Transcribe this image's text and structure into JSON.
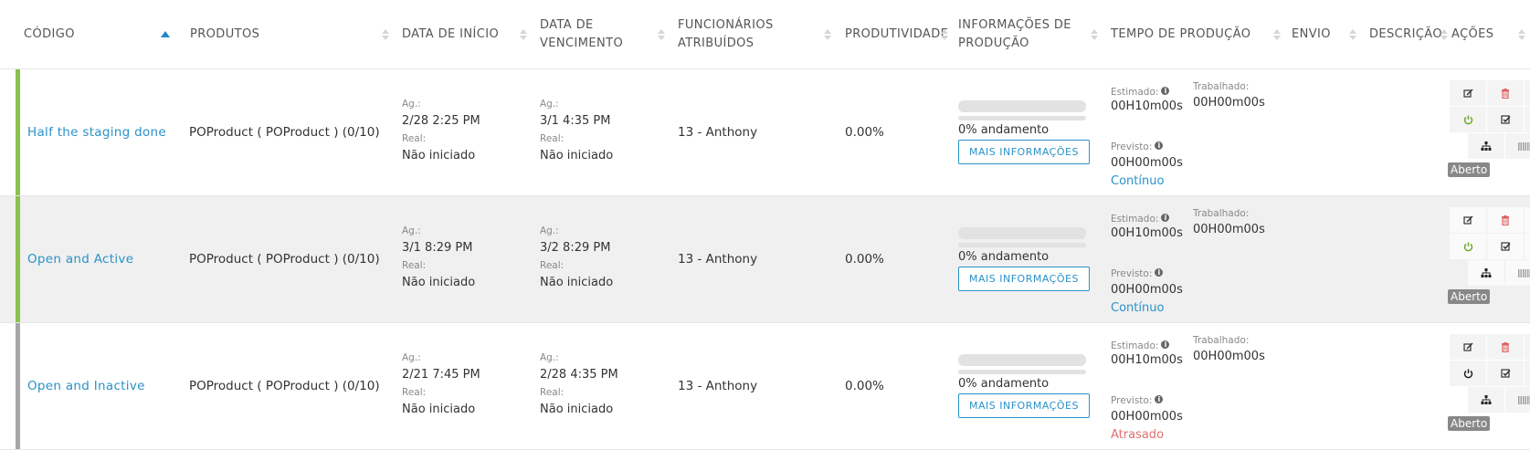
{
  "columns": [
    {
      "label": "CÓDIGO"
    },
    {
      "label": "PRODUTOS"
    },
    {
      "label": "DATA DE INÍCIO"
    },
    {
      "label": "DATA DE\nVENCIMENTO"
    },
    {
      "label": "FUNCIONÁRIOS\nATRIBUÍDOS"
    },
    {
      "label": "PRODUTIVIDADE"
    },
    {
      "label": "INFORMAÇÕES DE\nPRODUÇÃO"
    },
    {
      "label": "TEMPO DE PRODUÇÃO"
    },
    {
      "label": "ENVIO"
    },
    {
      "label": "DESCRIÇÃO"
    },
    {
      "label": "AÇÕES"
    }
  ],
  "labels": {
    "planned": "Ag.:",
    "real": "Real:",
    "estimated": "Estimado:",
    "worked": "Trabalhado:",
    "forecast": "Previsto:",
    "more_info": "MAIS INFORMAÇÕES"
  },
  "rows": [
    {
      "code": "Half the staging done",
      "product": "POProduct ( POProduct ) (0/10)",
      "start_planned": "2/28   2:25 PM",
      "start_real": "Não iniciado",
      "due_planned": "3/1   4:35 PM",
      "due_real": "Não iniciado",
      "assigned": "13 - Anthony",
      "productivity": "0.00%",
      "progress_label": "0% andamento",
      "progress": 0,
      "estimated": "00H10m00s",
      "worked": "00H00m00s",
      "forecast": "00H00m00s",
      "status_text": "Contínuo",
      "badge": "Aberto",
      "stripe_color": "#8cc14c",
      "power_color": "#6aaa2a"
    },
    {
      "code": "Open and Active",
      "product": "POProduct ( POProduct ) (0/10)",
      "start_planned": "3/1   8:29 PM",
      "start_real": "Não iniciado",
      "due_planned": "3/2   8:29 PM",
      "due_real": "Não iniciado",
      "assigned": "13 - Anthony",
      "productivity": "0.00%",
      "progress_label": "0% andamento",
      "progress": 0,
      "estimated": "00H10m00s",
      "worked": "00H00m00s",
      "forecast": "00H00m00s",
      "status_text": "Contínuo",
      "badge": "Aberto",
      "stripe_color": "#8cc14c",
      "power_color": "#6aaa2a"
    },
    {
      "code": "Open and Inactive",
      "product": "POProduct ( POProduct ) (0/10)",
      "start_planned": "2/21   7:45 PM",
      "start_real": "Não iniciado",
      "due_planned": "2/28   4:35 PM",
      "due_real": "Não iniciado",
      "assigned": "13 - Anthony",
      "productivity": "0.00%",
      "progress_label": "0% andamento",
      "progress": 0,
      "estimated": "00H10m00s",
      "worked": "00H00m00s",
      "forecast": "00H00m00s",
      "status_text": "Atrasado",
      "badge": "Aberto",
      "stripe_color": "#a7a7a7",
      "power_color": "#222222"
    }
  ],
  "icons": [
    "edit-icon",
    "trash-icon",
    "file-icon",
    "power-icon",
    "checklist-icon",
    "download-icon",
    "hierarchy-icon",
    "barcode-icon"
  ]
}
